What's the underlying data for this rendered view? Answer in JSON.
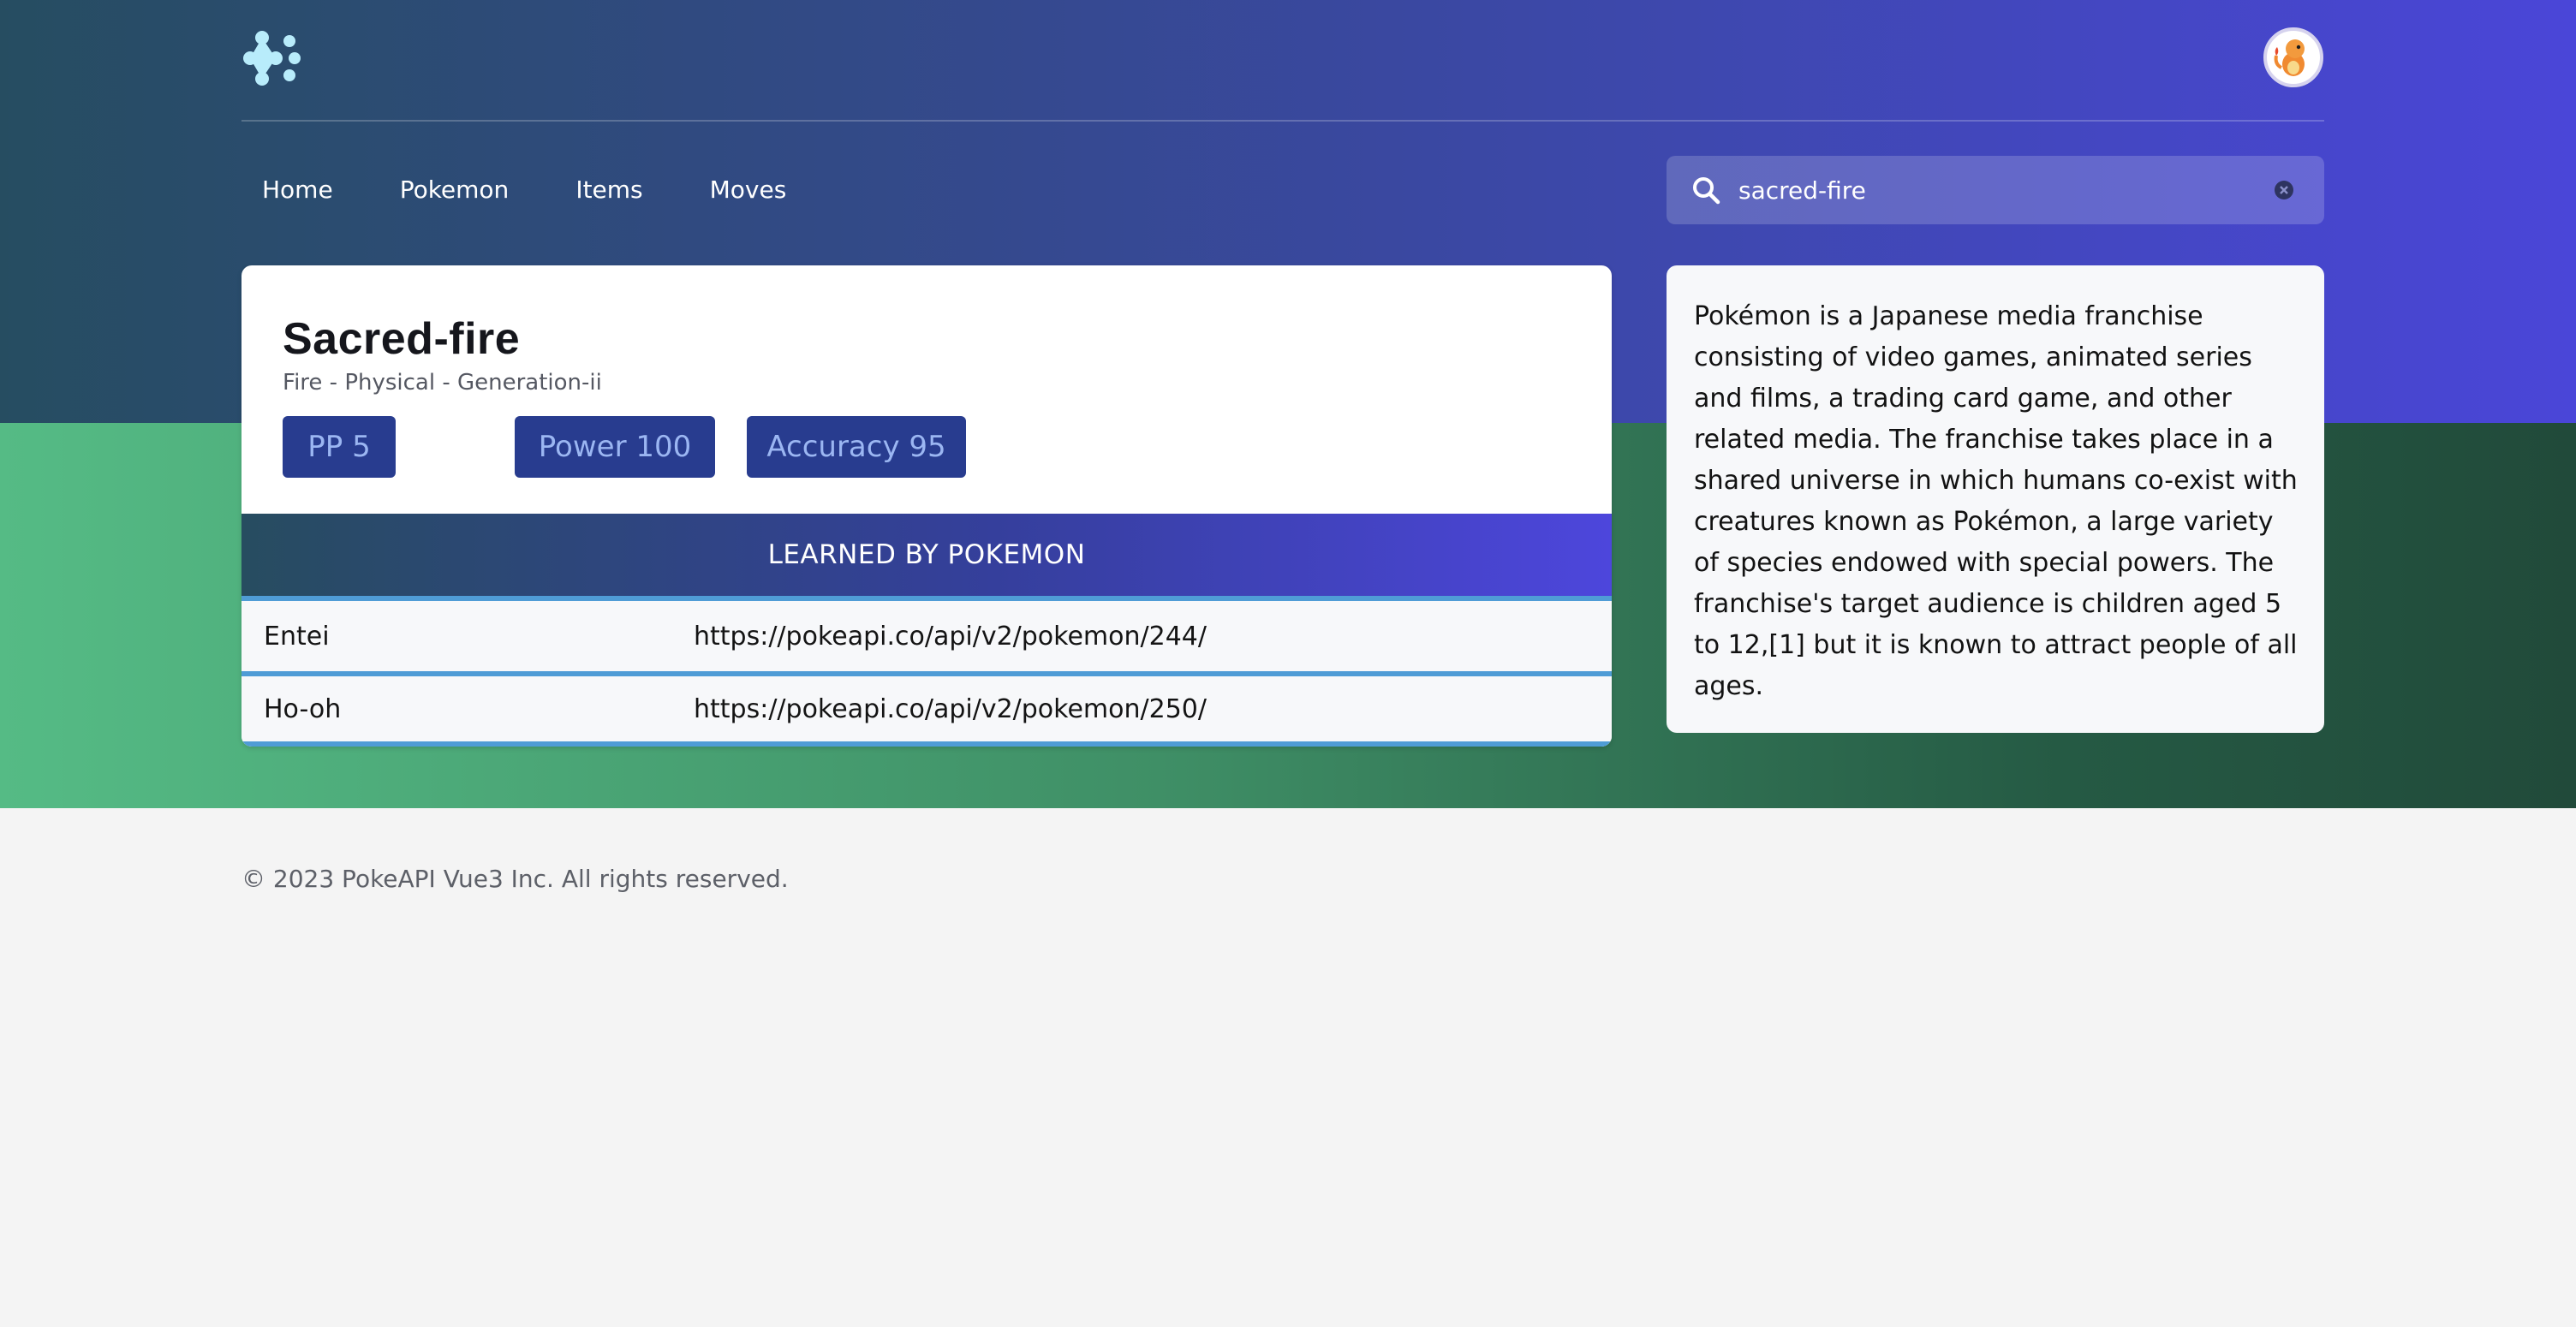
{
  "header": {
    "logo": "pokeapi-logo-icon",
    "avatar": "charmander-avatar"
  },
  "nav": {
    "items": [
      {
        "label": "Home"
      },
      {
        "label": "Pokemon"
      },
      {
        "label": "Items"
      },
      {
        "label": "Moves"
      }
    ]
  },
  "search": {
    "value": "sacred-fire",
    "icon": "search-icon",
    "clear_icon": "clear-icon"
  },
  "move": {
    "title": "Sacred-fire",
    "subtitle": "Fire - Physical - Generation-ii",
    "stats": {
      "pp": "PP 5",
      "power": "Power 100",
      "accuracy": "Accuracy 95"
    }
  },
  "learned_by": {
    "header": "LEARNED BY POKEMON",
    "rows": [
      {
        "name": "Entei",
        "url": "https://pokeapi.co/api/v2/pokemon/244/"
      },
      {
        "name": "Ho-oh",
        "url": "https://pokeapi.co/api/v2/pokemon/250/"
      }
    ]
  },
  "info": {
    "text": "Pokémon is a Japanese media franchise consisting of video games, animated series and films, a trading card game, and other related media. The franchise takes place in a shared universe in which humans co-exist with creatures known as Pokémon, a large variety of species endowed with special powers. The franchise's target audience is children aged 5 to 12,[1] but it is known to attract people of all ages."
  },
  "footer": {
    "text": "© 2023 PokeAPI Vue3 Inc. All rights reserved."
  },
  "colors": {
    "header_gradient_start": "#264d61",
    "header_gradient_end": "#4a46d8",
    "band_green": "#55bb85",
    "badge_bg": "#283c8f",
    "row_border": "#4f9cd6"
  }
}
